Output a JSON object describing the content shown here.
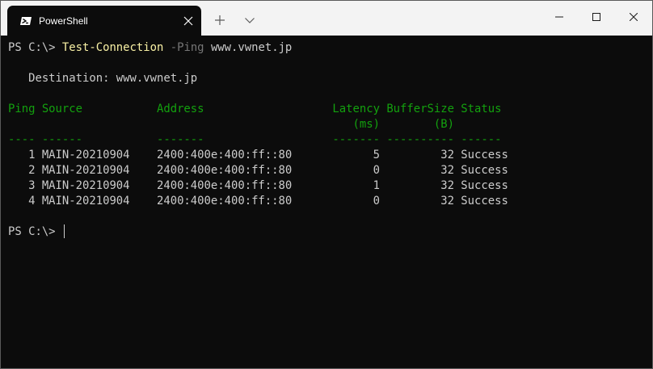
{
  "tab": {
    "title": "PowerShell",
    "icon": "powershell-icon"
  },
  "window_controls": [
    "minimize-icon",
    "maximize-icon",
    "close-icon"
  ],
  "colors": {
    "titlebar": "#f3f3f3",
    "terminal_bg": "#0c0c0c",
    "text": "#cccccc",
    "header": "#13a10e",
    "command": "#f9f1a5",
    "parameter": "#767676"
  },
  "command": {
    "prompt": "PS C:\\> ",
    "cmdlet": "Test-Connection",
    "parameter": "-Ping",
    "argument": "www.vwnet.jp"
  },
  "destination_line": "   Destination: www.vwnet.jp",
  "table": {
    "header_line1": "Ping Source           Address                   Latency BufferSize Status",
    "header_line2": "                                                   (ms)        (B)",
    "separator": "---- ------           -------                   ------- ---------- ------",
    "rows": [
      "   1 MAIN-20210904    2400:400e:400:ff::80            5         32 Success",
      "   2 MAIN-20210904    2400:400e:400:ff::80            0         32 Success",
      "   3 MAIN-20210904    2400:400e:400:ff::80            1         32 Success",
      "   4 MAIN-20210904    2400:400e:400:ff::80            0         32 Success"
    ]
  },
  "final_prompt": "PS C:\\> "
}
